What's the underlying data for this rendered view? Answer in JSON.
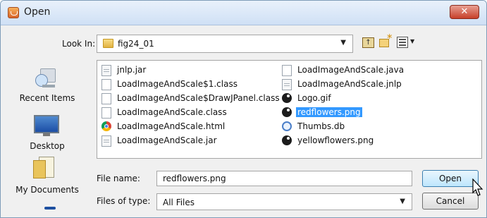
{
  "title_bar": {
    "title": "Open",
    "close_glyph": "✕"
  },
  "toolbar": {
    "look_in_label": "Look In:",
    "look_in_value": "fig24_01",
    "combo_arrow": "▼",
    "icons": [
      "up-folder-icon",
      "new-folder-icon",
      "details-view-icon"
    ]
  },
  "places": [
    {
      "label": "Recent Items",
      "icon": "recent-items-icon"
    },
    {
      "label": "Desktop",
      "icon": "desktop-icon"
    },
    {
      "label": "My Documents",
      "icon": "my-documents-icon"
    },
    {
      "label": "",
      "icon": "computer-icon"
    }
  ],
  "files": [
    {
      "name": "jnlp.jar",
      "icon": "jar-file-icon",
      "selected": false
    },
    {
      "name": "LoadImageAndScale$1.class",
      "icon": "file-icon",
      "selected": false
    },
    {
      "name": "LoadImageAndScale$DrawJPanel.class",
      "icon": "file-icon",
      "selected": false
    },
    {
      "name": "LoadImageAndScale.class",
      "icon": "file-icon",
      "selected": false
    },
    {
      "name": "LoadImageAndScale.html",
      "icon": "chrome-html-icon",
      "selected": false
    },
    {
      "name": "LoadImageAndScale.jar",
      "icon": "jar-file-icon",
      "selected": false
    },
    {
      "name": "LoadImageAndScale.java",
      "icon": "blank-file-icon",
      "selected": false
    },
    {
      "name": "LoadImageAndScale.jnlp",
      "icon": "jnlp-file-icon",
      "selected": false
    },
    {
      "name": "Logo.gif",
      "icon": "image-file-icon",
      "selected": false
    },
    {
      "name": "redflowers.png",
      "icon": "image-file-icon",
      "selected": true
    },
    {
      "name": "Thumbs.db",
      "icon": "thumbs-db-icon",
      "selected": false
    },
    {
      "name": "yellowflowers.png",
      "icon": "image-file-icon",
      "selected": false
    }
  ],
  "file_name": {
    "label": "File name:",
    "value": "redflowers.png"
  },
  "file_type": {
    "label": "Files of type:",
    "value": "All Files",
    "arrow": "▼"
  },
  "buttons": {
    "open": "Open",
    "cancel": "Cancel"
  }
}
